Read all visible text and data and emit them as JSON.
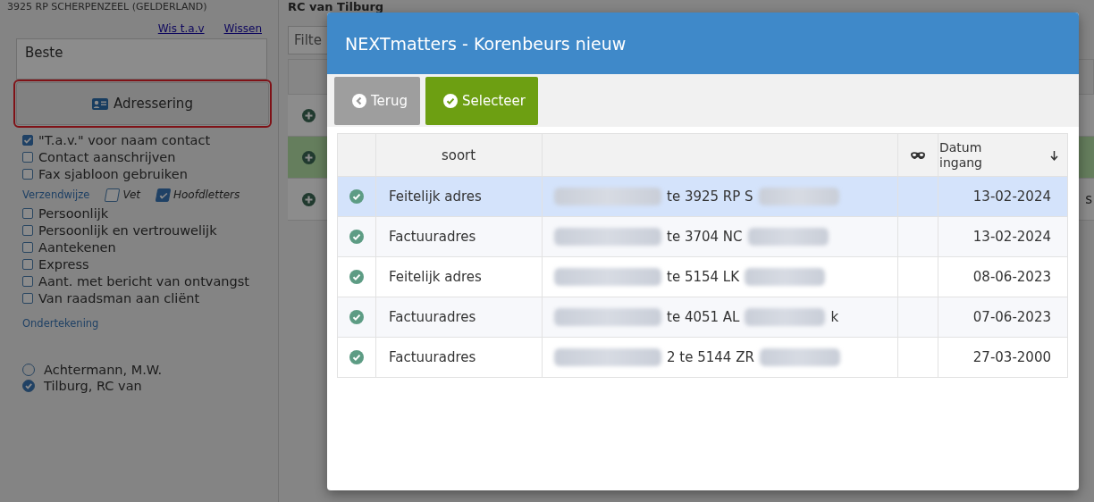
{
  "left_panel": {
    "address_line": "3925 RP  SCHERPENZEEL (GELDERLAND)",
    "links": [
      "Wis t.a.v",
      "Wissen"
    ],
    "salutation": "Beste",
    "address_button": "Adressering",
    "options": [
      {
        "label": "\"T.a.v.\" voor naam contact",
        "checked": true
      },
      {
        "label": "Contact aanschrijven",
        "checked": false
      },
      {
        "label": "Fax sjabloon gebruiken",
        "checked": false
      }
    ],
    "shipping_label": "Verzendwijze",
    "styles": [
      {
        "label": "Vet",
        "checked": false
      },
      {
        "label": "Hoofdletters",
        "checked": true
      }
    ],
    "shipping": [
      {
        "label": "Persoonlijk",
        "checked": false
      },
      {
        "label": "Persoonlijk en vertrouwelijk",
        "checked": false
      },
      {
        "label": "Aantekenen",
        "checked": false
      },
      {
        "label": "Express",
        "checked": false
      },
      {
        "label": "Aant. met bericht van ontvangst",
        "checked": false
      },
      {
        "label": "Van raadsman aan cliënt",
        "checked": false
      }
    ],
    "signature_label": "Ondertekening",
    "signers": [
      {
        "label": "Achtermann, M.W.",
        "selected": false
      },
      {
        "label": "Tilburg, RC van",
        "selected": true
      }
    ]
  },
  "main_panel": {
    "title": "RC van Tilburg",
    "filter_placeholder": "Filte",
    "rows": [
      {
        "selected": false
      },
      {
        "selected": true
      },
      {
        "selected": false
      }
    ],
    "edge_text": "s"
  },
  "dialog": {
    "title": "NEXTmatters - Korenbeurs nieuw",
    "buttons": [
      {
        "kind": "back",
        "label": "Terug"
      },
      {
        "kind": "select",
        "label": "Selecteer"
      }
    ],
    "columns": [
      "soort",
      "Datum ingang"
    ],
    "rows": [
      {
        "selected": true,
        "soort": "Feitelijk adres",
        "address": [
          {
            "kind": "blur"
          },
          {
            "kind": "text",
            "text": "te 3925 RP S"
          },
          {
            "kind": "blur"
          }
        ],
        "date": "13-02-2024"
      },
      {
        "selected": false,
        "soort": "Factuuradres",
        "address": [
          {
            "kind": "blur"
          },
          {
            "kind": "text",
            "text": "te 3704 NC"
          },
          {
            "kind": "blur"
          }
        ],
        "date": "13-02-2024"
      },
      {
        "selected": false,
        "soort": "Feitelijk adres",
        "address": [
          {
            "kind": "blur"
          },
          {
            "kind": "text",
            "text": "te 5154 LK"
          },
          {
            "kind": "blur"
          }
        ],
        "date": "08-06-2023"
      },
      {
        "selected": false,
        "soort": "Factuuradres",
        "address": [
          {
            "kind": "blur"
          },
          {
            "kind": "text",
            "text": "te 4051 AL"
          },
          {
            "kind": "blur"
          },
          {
            "kind": "text",
            "text": "k"
          }
        ],
        "date": "07-06-2023"
      },
      {
        "selected": false,
        "soort": "Factuuradres",
        "address": [
          {
            "kind": "blur"
          },
          {
            "kind": "text",
            "text": "2 te 5144 ZR"
          },
          {
            "kind": "blur"
          }
        ],
        "date": "27-03-2000"
      }
    ]
  }
}
